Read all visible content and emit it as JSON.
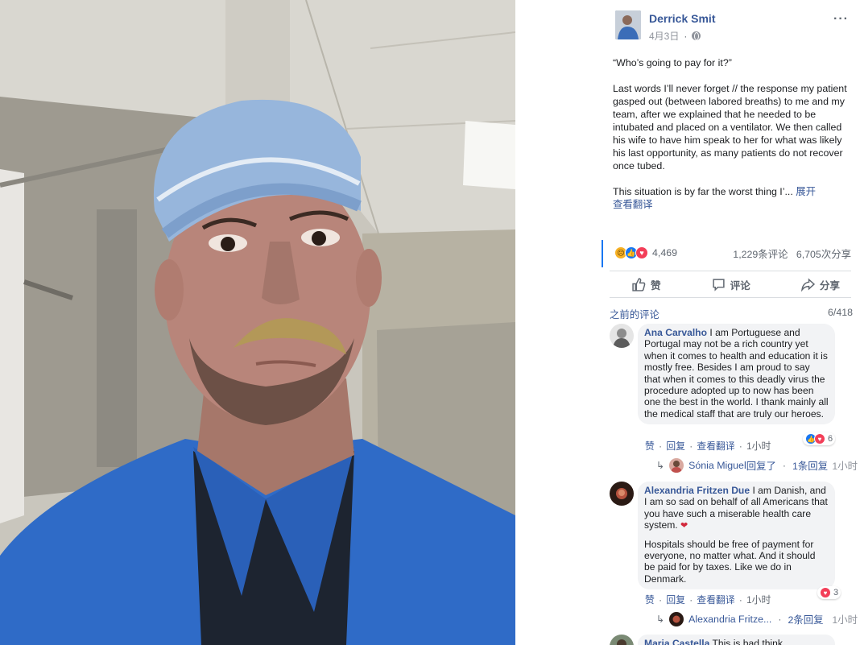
{
  "post": {
    "author": "Derrick Smit",
    "date": "4月3日",
    "menu_icon": "more-horizontal-icon",
    "quote": "“Who’s going to pay for it?”",
    "paragraph1": "Last words I’ll never forget // the response my patient gasped out (between labored breaths) to me and my team, after we explained that he needed to be intubated and placed on a ventilator. We then called his wife to have him speak to her for what was likely his last opportunity, as many patients do not recover once tubed.",
    "paragraph2": "This situation is by far the worst thing I’...",
    "expand_label": "展开",
    "see_translation": "查看翻译"
  },
  "stats": {
    "reactions_count": "4,469",
    "comments_count": "1,229条评论",
    "shares_count": "6,705次分享"
  },
  "actions": {
    "like": "赞",
    "comment": "评论",
    "share": "分享"
  },
  "comments_header": {
    "previous_label": "之前的评论",
    "count": "6/418"
  },
  "comments": [
    {
      "name": "Ana Carvalho",
      "text": "I am Portuguese and Portugal may not be a rich country yet when it comes to health and education it is mostly free. Besides I am proud to say that when it comes to this deadly virus the procedure adopted up to now has been one the best in the world. I thank mainly all the medical staff that are truly our heroes.",
      "like": "赞",
      "reply": "回复",
      "translate": "查看翻译",
      "time": "1小时",
      "react_count": "6",
      "reply_summary": {
        "replier": "Sónia Miguel",
        "replied": "回复了",
        "count": "1条回复",
        "time": "1小时"
      }
    },
    {
      "name": "Alexandria Fritzen Due",
      "text1": "I am Danish, and I am so sad on behalf of all Americans that you have such a miserable health care system.",
      "text2": "Hospitals should be free of payment for everyone, no matter what. And it should be paid for by taxes. Like we do in Denmark.",
      "like": "赞",
      "reply": "回复",
      "translate": "查看翻译",
      "time": "1小时",
      "react_count": "3",
      "reply_summary": {
        "replier": "Alexandria Fritze...",
        "count": "2条回复",
        "time": "1小时"
      }
    },
    {
      "name": "Maria Castella",
      "text": "This is bad think"
    }
  ],
  "colors": {
    "link": "#385898",
    "accent": "#1877f2",
    "muted": "#606770",
    "bubble": "#f2f3f5"
  }
}
